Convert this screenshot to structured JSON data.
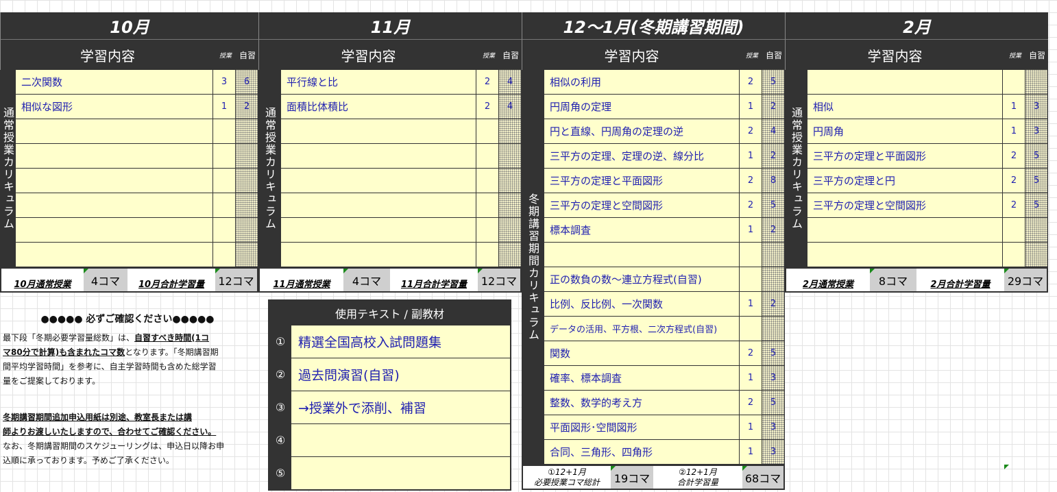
{
  "months": {
    "oct": {
      "title": "10月"
    },
    "nov": {
      "title": "11月"
    },
    "winter": {
      "title": "12～1月(冬期講習期間)"
    },
    "feb": {
      "title": "2月"
    }
  },
  "subheader": {
    "content": "学習内容",
    "lesson": "授業",
    "self": "自習"
  },
  "sidebar": {
    "regular": "通常授業カリキュラム",
    "winter": "冬期講習期間カリキュラム"
  },
  "oct_rows": [
    {
      "topic": "二次関数",
      "lesson": "3",
      "self": "6"
    },
    {
      "topic": "相似な図形",
      "lesson": "1",
      "self": "2"
    }
  ],
  "nov_rows": [
    {
      "topic": "平行線と比",
      "lesson": "2",
      "self": "4"
    },
    {
      "topic": "面積比体積比",
      "lesson": "2",
      "self": "4"
    }
  ],
  "winter_rows": [
    {
      "topic": "相似の利用",
      "lesson": "2",
      "self": "5"
    },
    {
      "topic": "円周角の定理",
      "lesson": "1",
      "self": "2"
    },
    {
      "topic": "円と直線、円周角の定理の逆",
      "lesson": "2",
      "self": "4"
    },
    {
      "topic": "三平方の定理、定理の逆、線分比",
      "lesson": "1",
      "self": "2"
    },
    {
      "topic": "三平方の定理と平面図形",
      "lesson": "2",
      "self": "8"
    },
    {
      "topic": "三平方の定理と空間図形",
      "lesson": "2",
      "self": "5"
    },
    {
      "topic": "標本調査",
      "lesson": "1",
      "self": "2"
    },
    {
      "topic": "",
      "lesson": "",
      "self": ""
    },
    {
      "topic": "正の数負の数～連立方程式(自習)",
      "lesson": "",
      "self": ""
    },
    {
      "topic": "比例、反比例、一次関数",
      "lesson": "1",
      "self": "2"
    },
    {
      "topic": "データの活用、平方根、二次方程式(自習)",
      "lesson": "",
      "self": ""
    },
    {
      "topic": "関数",
      "lesson": "2",
      "self": "5"
    },
    {
      "topic": "確率、標本調査",
      "lesson": "1",
      "self": "3"
    },
    {
      "topic": "整数、数学的考え方",
      "lesson": "2",
      "self": "5"
    },
    {
      "topic": "平面図形･空間図形",
      "lesson": "1",
      "self": "3"
    },
    {
      "topic": "合同、三角形、四角形",
      "lesson": "1",
      "self": "3"
    }
  ],
  "feb_rows": [
    {
      "topic": "",
      "lesson": "",
      "self": ""
    },
    {
      "topic": "相似",
      "lesson": "1",
      "self": "3"
    },
    {
      "topic": "円周角",
      "lesson": "1",
      "self": "3"
    },
    {
      "topic": "三平方の定理と平面図形",
      "lesson": "2",
      "self": "5"
    },
    {
      "topic": "三平方の定理と円",
      "lesson": "2",
      "self": "5"
    },
    {
      "topic": "三平方の定理と空間図形",
      "lesson": "2",
      "self": "5"
    }
  ],
  "footers": {
    "oct": {
      "regular_label": "10月通常授業",
      "regular_value": "4コマ",
      "total_label": "10月合計学習量",
      "total_value": "12コマ"
    },
    "nov": {
      "regular_label": "11月通常授業",
      "regular_value": "4コマ",
      "total_label": "11月合計学習量",
      "total_value": "12コマ"
    },
    "feb": {
      "regular_label": "2月通常授業",
      "regular_value": "8コマ",
      "total_label": "2月合計学習量",
      "total_value": "29コマ"
    },
    "winter": {
      "required_label_1": "①12+1月",
      "required_label_2": "必要授業コマ総計",
      "required_value": "19コマ",
      "total_label_1": "②12+1月",
      "total_label_2": "合計学習量",
      "total_value": "68コマ"
    }
  },
  "notice": {
    "title": "●●●●● 必ずご確認ください●●●●●",
    "p1_a": "最下段「冬期必要学習量総数」は、",
    "p1_b": "自習すべき時間(1コ",
    "p1_c": "マ80分で計算)も含まれたコマ数",
    "p1_d": "となります。「冬期講習期",
    "p1_e": "間平均学習時間」を参考に、自主学習時間も含めた総学習",
    "p1_f": "量をご提案しております。",
    "p2_a": "冬期講習期間追加申込用紙は別途、教室長または講",
    "p2_b": "師よりお渡しいたしますので、合わせてご確認ください。",
    "p2_c": "なお、冬期講習期間のスケジューリングは、申込日以降お申",
    "p2_d": "込順に承っております。予めご了承ください。"
  },
  "textbooks": {
    "header": "使用テキスト / 副教材",
    "items": [
      {
        "num": "①",
        "text": "精選全国高校入試問題集"
      },
      {
        "num": "②",
        "text": "過去問演習(自習)"
      },
      {
        "num": "③",
        "text": "→授業外で添削、補習"
      },
      {
        "num": "④",
        "text": ""
      },
      {
        "num": "⑤",
        "text": ""
      }
    ]
  }
}
